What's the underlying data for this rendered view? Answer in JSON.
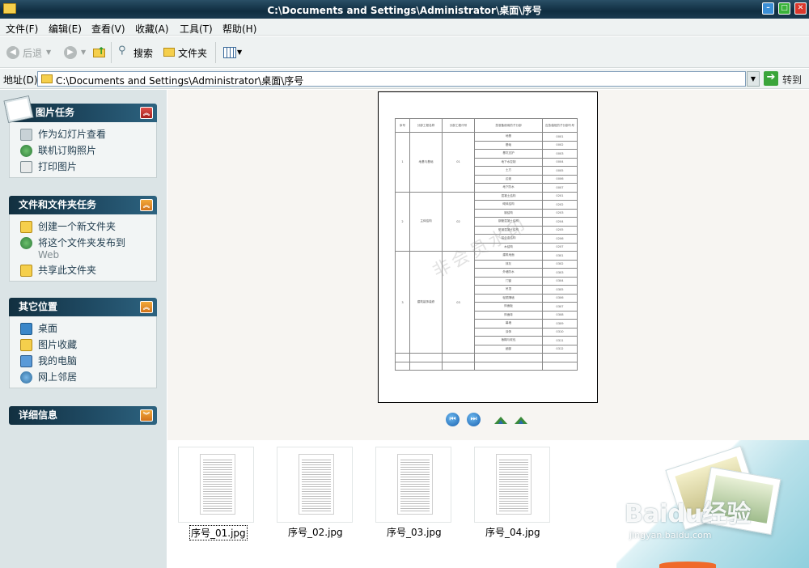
{
  "window": {
    "title": "C:\\Documents and Settings\\Administrator\\桌面\\序号",
    "minimize": "–",
    "maximize": "□",
    "close": "✕"
  },
  "menu": [
    "文件(F)",
    "编辑(E)",
    "查看(V)",
    "收藏(A)",
    "工具(T)",
    "帮助(H)"
  ],
  "toolbar": {
    "back": "后退",
    "search": "搜索",
    "folders": "文件夹"
  },
  "address": {
    "label": "地址(D)",
    "path": "C:\\Documents and Settings\\Administrator\\桌面\\序号",
    "go": "转到"
  },
  "sidebar": {
    "picture_tasks": {
      "title": "图片任务",
      "items": [
        "作为幻灯片查看",
        "联机订购照片",
        "打印图片"
      ]
    },
    "file_tasks": {
      "title": "文件和文件夹任务",
      "items": [
        "创建一个新文件夹",
        "将这个文件夹发布到",
        "共享此文件夹"
      ],
      "sub": "Web"
    },
    "other_places": {
      "title": "其它位置",
      "items": [
        "桌面",
        "图片收藏",
        "我的电脑",
        "网上邻居"
      ]
    },
    "details": {
      "title": "详细信息"
    }
  },
  "preview": {
    "watermark": "非会员水印",
    "headers": [
      "序号",
      "分部工程名称",
      "分部工程代号",
      "您准备使用的子分部",
      "应急值班的子分部代号"
    ],
    "groups": [
      {
        "no": "1",
        "name": "地基与基础",
        "code": "01"
      },
      {
        "no": "2",
        "name": "主体结构",
        "code": "02"
      },
      {
        "no": "3",
        "name": "建筑装饰装修",
        "code": "03"
      }
    ],
    "rows": [
      [
        "地基",
        "0001"
      ],
      [
        "基础",
        "0002"
      ],
      [
        "基坑支护",
        "0003"
      ],
      [
        "地下水控制",
        "0004"
      ],
      [
        "土方",
        "0005"
      ],
      [
        "边坡",
        "0006"
      ],
      [
        "地下防水",
        "0007"
      ],
      [
        "混凝土结构",
        "0201"
      ],
      [
        "砌体结构",
        "0202"
      ],
      [
        "钢结构",
        "0203"
      ],
      [
        "钢管混凝土结构",
        "0204"
      ],
      [
        "型钢混凝土结构",
        "0205"
      ],
      [
        "铝合金结构",
        "0206"
      ],
      [
        "木结构",
        "0207"
      ],
      [
        "建筑地面",
        "0301"
      ],
      [
        "抹灰",
        "0302"
      ],
      [
        "外墙防水",
        "0303"
      ],
      [
        "门窗",
        "0304"
      ],
      [
        "吊顶",
        "0305"
      ],
      [
        "轻质隔墙",
        "0306"
      ],
      [
        "饰面板",
        "0307"
      ],
      [
        "饰面砖",
        "0308"
      ],
      [
        "幕墙",
        "0309"
      ],
      [
        "涂饰",
        "0310"
      ],
      [
        "裱糊与软包",
        "0311"
      ],
      [
        "细部",
        "0312"
      ]
    ]
  },
  "thumbnails": [
    "序号_01.jpg",
    "序号_02.jpg",
    "序号_03.jpg",
    "序号_04.jpg"
  ],
  "brand": {
    "logo_text": "Baidu经验",
    "url": "jingyan.baidu.com"
  }
}
